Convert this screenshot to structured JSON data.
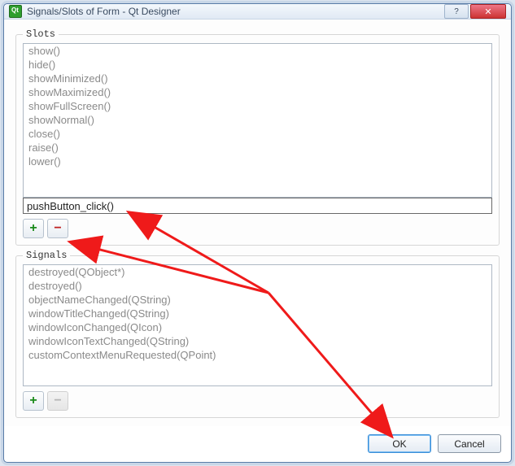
{
  "window": {
    "title": "Signals/Slots of Form - Qt Designer"
  },
  "slots": {
    "label": "Slots",
    "items": [
      "show()",
      "hide()",
      "showMinimized()",
      "showMaximized()",
      "showFullScreen()",
      "showNormal()",
      "close()",
      "raise()",
      "lower()"
    ],
    "editing_value": "pushButton_click()"
  },
  "signals": {
    "label": "Signals",
    "items": [
      "destroyed(QObject*)",
      "destroyed()",
      "objectNameChanged(QString)",
      "windowTitleChanged(QString)",
      "windowIconChanged(QIcon)",
      "windowIconTextChanged(QString)",
      "customContextMenuRequested(QPoint)"
    ]
  },
  "buttons": {
    "ok": "OK",
    "cancel": "Cancel"
  }
}
